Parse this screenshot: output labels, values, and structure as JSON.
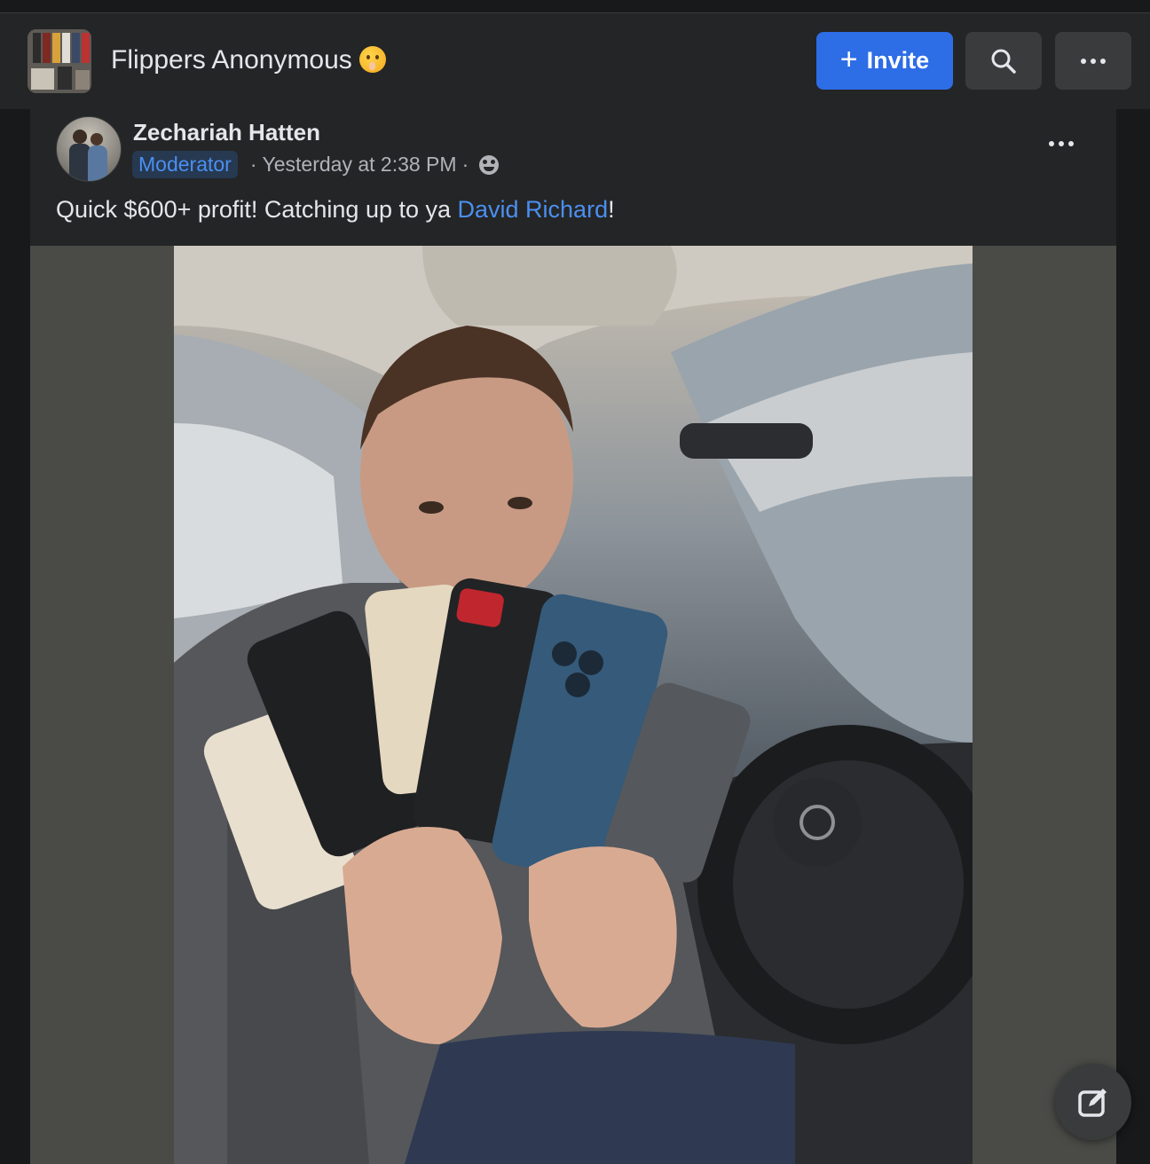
{
  "group": {
    "name": "Flippers Anonymous",
    "emoji_icon": "shushing-face-icon"
  },
  "header": {
    "invite_label": "Invite",
    "search_icon": "search-icon",
    "more_icon": "more-icon"
  },
  "post": {
    "author": "Zechariah Hatten",
    "role_badge": "Moderator",
    "timestamp": "Yesterday at 2:38 PM",
    "separator": "·",
    "privacy_icon": "members-icon",
    "text_before": "Quick $600+ profit! Catching up to ya ",
    "mention": "David Richard",
    "text_after": "!"
  },
  "colors": {
    "accent": "#2d6de6",
    "link": "#4b8ff0",
    "surface": "#242526",
    "background": "#18191a"
  }
}
